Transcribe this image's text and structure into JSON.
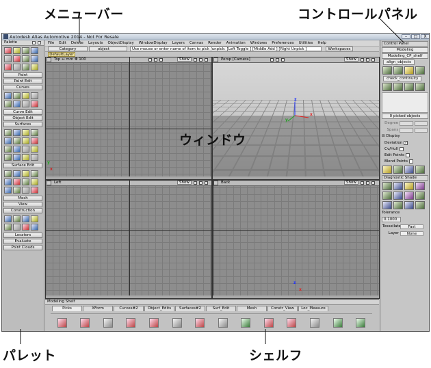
{
  "annotations": {
    "menubar": "メニューバー",
    "control_panel": "コントロールパネル",
    "window": "ウィンドウ",
    "palette": "パレット",
    "shelf": "シェルフ"
  },
  "app": {
    "title": "Autodesk Alias Automotive 2014 - Not For Resale",
    "window_controls": [
      "–",
      "□",
      "X"
    ]
  },
  "menubar": {
    "items": [
      "File",
      "Edit",
      "Delete",
      "Layouts",
      "ObjectDisplay",
      "WindowDisplay",
      "Layers",
      "Canvas",
      "Render",
      "Animation",
      "Windows",
      "Preferences",
      "Utilities",
      "Help"
    ]
  },
  "toolbar": {
    "category": "Category",
    "object": "object",
    "message": "Use mouse or enter name of item to pick /unpick: [Left Toggle ] [Middle Add ] [Right Unpick ]",
    "workspaces": "Workspaces"
  },
  "layerbar": {
    "default_layer": "DefaultLayer"
  },
  "palette": {
    "title": "Palette",
    "sections": [
      "Paint",
      "Paint Edit",
      "Curves",
      "Curve Edit",
      "Object Edit",
      "Surfaces",
      "Surface Edit",
      "Mesh",
      "View",
      "Construction",
      "Locators",
      "Evaluate",
      "Point Clouds"
    ]
  },
  "viewports": {
    "top": {
      "name": "Top",
      "units": "mm",
      "scale": "100",
      "show": "Show"
    },
    "persp": {
      "name": "Persp [Camera]",
      "show": "Show"
    },
    "left": {
      "name": "Left",
      "show": "Show"
    },
    "back": {
      "name": "Back",
      "show": "Show"
    }
  },
  "control_panel": {
    "title": "Control Panel",
    "mode": "Modeling",
    "shelf_dropdown": "Modeling_CP_shelf",
    "tabs": [
      "align_objects",
      "check_continuity"
    ],
    "picked": "0 picked objects",
    "degree_label": "Degree",
    "spans_label": "Spans",
    "display_section": "Display",
    "checks": [
      {
        "label": "Deviation",
        "checked": "✓"
      },
      {
        "label": "Cv/Hull",
        "checked": ""
      },
      {
        "label": "Edit Points",
        "checked": ""
      },
      {
        "label": "Blend Points",
        "checked": ""
      }
    ],
    "diagnostic_title": "Diagnostic Shade",
    "tolerance_label": "Tolerance",
    "tolerance_value": "0.1000",
    "tessellate_label": "Tessellate",
    "tessellate_value": "Fast",
    "layer_label": "Layer",
    "layer_value": "None"
  },
  "shelf": {
    "title": "Modeling Shelf",
    "tabs": [
      "Picks",
      "XForm",
      "Curves#2",
      "Object_Edits",
      "Surfaces#2",
      "Surf_Edit",
      "Mesh",
      "Constr_View",
      "Loc_Measure"
    ]
  },
  "axis_labels": {
    "x": "x",
    "y": "y",
    "z": "z"
  }
}
